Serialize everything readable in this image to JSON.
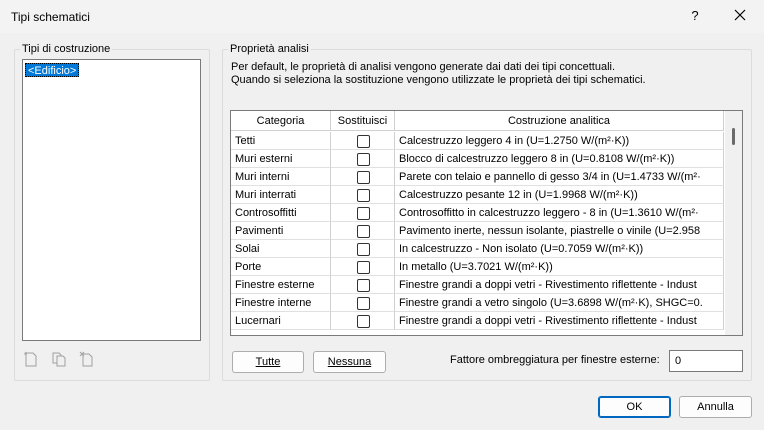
{
  "window": {
    "title": "Tipi schematici",
    "help": "?"
  },
  "left_panel": {
    "group_label": "Tipi di costruzione",
    "items": [
      "<Edificio>"
    ],
    "icons": [
      "new-type-icon",
      "duplicate-type-icon",
      "delete-type-icon"
    ]
  },
  "right_panel": {
    "group_label": "Proprietà analisi",
    "description_line1": "Per default, le proprietà di analisi vengono generate dai dati dei tipi concettuali.",
    "description_line2": "Quando si seleziona la sostituzione vengono utilizzate le proprietà dei tipi schematici.",
    "columns": [
      "Categoria",
      "Sostituisci",
      "Costruzione analitica"
    ],
    "rows": [
      {
        "category": "Tetti",
        "override": false,
        "construction": "Calcestruzzo leggero 4 in (U=1.2750 W/(m²·K))"
      },
      {
        "category": "Muri esterni",
        "override": false,
        "construction": "Blocco di calcestruzzo leggero 8 in (U=0.8108 W/(m²·K))"
      },
      {
        "category": "Muri interni",
        "override": false,
        "construction": "Parete con telaio e pannello di gesso 3/4 in (U=1.4733 W/(m²·"
      },
      {
        "category": "Muri interrati",
        "override": false,
        "construction": "Calcestruzzo pesante 12 in (U=1.9968 W/(m²·K))"
      },
      {
        "category": "Controsoffitti",
        "override": false,
        "construction": "Controsoffitto in calcestruzzo leggero - 8 in (U=1.3610 W/(m²·"
      },
      {
        "category": "Pavimenti",
        "override": false,
        "construction": "Pavimento inerte, nessun isolante, piastrelle o vinile (U=2.958"
      },
      {
        "category": "Solai",
        "override": false,
        "construction": "In calcestruzzo - Non isolato (U=0.7059 W/(m²·K))"
      },
      {
        "category": "Porte",
        "override": false,
        "construction": "In metallo (U=3.7021 W/(m²·K))"
      },
      {
        "category": "Finestre esterne",
        "override": false,
        "construction": "Finestre grandi a doppi vetri - Rivestimento riflettente - Indust"
      },
      {
        "category": "Finestre interne",
        "override": false,
        "construction": "Finestre grandi a vetro singolo (U=3.6898 W/(m²·K), SHGC=0."
      },
      {
        "category": "Lucernari",
        "override": false,
        "construction": "Finestre grandi a doppi vetri - Rivestimento riflettente - Indust"
      }
    ],
    "buttons": {
      "all": "Tutte",
      "none": "Nessuna"
    },
    "shading_label": "Fattore ombreggiatura per finestre esterne:",
    "shading_value": "0"
  },
  "footer": {
    "ok": "OK",
    "cancel": "Annulla"
  }
}
